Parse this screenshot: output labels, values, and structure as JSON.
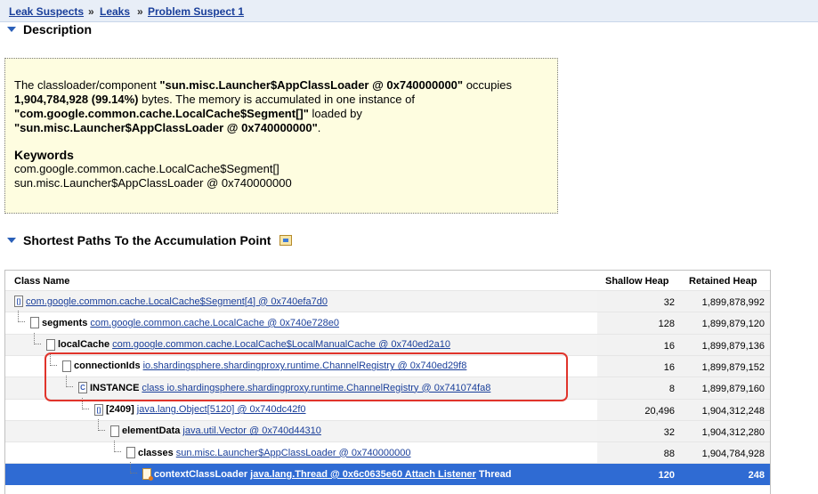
{
  "breadcrumbs": [
    "Leak Suspects",
    "Leaks",
    "Problem Suspect 1"
  ],
  "breadcrumb_separator": "»",
  "description": {
    "heading": "Description",
    "text_parts": {
      "p1": "The classloader/component ",
      "b1": "\"sun.misc.Launcher$AppClassLoader @ 0x740000000\"",
      "p2": " occupies ",
      "b2": "1,904,784,928 (99.14%)",
      "p3": " bytes. The memory is accumulated in one instance of ",
      "b3": "\"com.google.common.cache.LocalCache$Segment[]\"",
      "p4": " loaded by ",
      "b4": "\"sun.misc.Launcher$AppClassLoader @ 0x740000000\"",
      "p5": "."
    },
    "keywords_title": "Keywords",
    "keywords": [
      "com.google.common.cache.LocalCache$Segment[]",
      "sun.misc.Launcher$AppClassLoader @ 0x740000000"
    ]
  },
  "paths": {
    "heading": "Shortest Paths To the Accumulation Point",
    "columns": {
      "name": "Class Name",
      "shallow": "Shallow Heap",
      "retained": "Retained Heap"
    },
    "rows": [
      {
        "field": "",
        "link": "com.google.common.cache.LocalCache$Segment[4] @ 0x740efa7d0",
        "suffix": "",
        "shallow": "32",
        "retained": "1,899,878,992",
        "icon": "arr"
      },
      {
        "field": "segments",
        "link": "com.google.common.cache.LocalCache @ 0x740e728e0",
        "suffix": "",
        "shallow": "128",
        "retained": "1,899,879,120",
        "icon": "obj"
      },
      {
        "field": "localCache",
        "link": "com.google.common.cache.LocalCache$LocalManualCache @ 0x740ed2a10",
        "suffix": "",
        "shallow": "16",
        "retained": "1,899,879,136",
        "icon": "obj"
      },
      {
        "field": "connectionIds",
        "link": "io.shardingsphere.shardingproxy.runtime.ChannelRegistry @ 0x740ed29f8",
        "suffix": "",
        "shallow": "16",
        "retained": "1,899,879,152",
        "icon": "obj"
      },
      {
        "field": "INSTANCE",
        "link": "class io.shardingsphere.shardingproxy.runtime.ChannelRegistry @ 0x741074fa8",
        "suffix": "",
        "shallow": "8",
        "retained": "1,899,879,160",
        "icon": "cls"
      },
      {
        "field": "[2409]",
        "link": "java.lang.Object[5120] @ 0x740dc42f0",
        "suffix": "",
        "shallow": "20,496",
        "retained": "1,904,312,248",
        "icon": "arr"
      },
      {
        "field": "elementData",
        "link": "java.util.Vector @ 0x740d44310",
        "suffix": "",
        "shallow": "32",
        "retained": "1,904,312,280",
        "icon": "obj"
      },
      {
        "field": "classes",
        "link": "sun.misc.Launcher$AppClassLoader @ 0x740000000",
        "suffix": "",
        "shallow": "88",
        "retained": "1,904,784,928",
        "icon": "obj"
      },
      {
        "field": "contextClassLoader",
        "link": "java.lang.Thread @ 0x6c0635e60 Attach Listener",
        "suffix": "Thread",
        "shallow": "120",
        "retained": "248",
        "icon": "thr"
      }
    ]
  },
  "colors": {
    "link": "#1a3f9a",
    "selection": "#2f6bd3",
    "desc_bg": "#fefde0",
    "highlight": "#e0342b"
  }
}
